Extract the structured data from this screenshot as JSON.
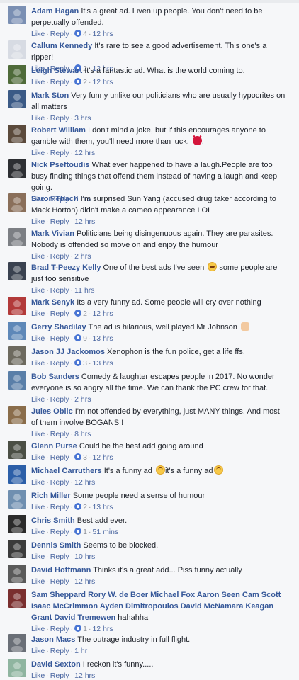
{
  "labels": {
    "like": "Like",
    "reply": "Reply",
    "sep": "·"
  },
  "colors": {
    "name": "#365899",
    "text": "#1d2129",
    "meta": "#90949c",
    "link": "#4b67a1",
    "reaction": "#4a76d4",
    "background": "#f6f7f9"
  },
  "comments": [
    {
      "name": "Adam Hagan",
      "text": "It's a great ad. Liven up people. You don't need to be perpetually offended.",
      "reactions": "4",
      "time": "12 hrs",
      "avatar": "avatar-photo"
    },
    {
      "name": "Callum Kennedy",
      "text": "It's rare to see a good advertisement. This one's a ripper!",
      "reactions": "2",
      "time": "12 hrs",
      "avatar": "avatar-photo"
    },
    {
      "name": "Leigh Stewart",
      "text": "It's a fantastic ad. What is the world coming to.",
      "reactions": "2",
      "time": "12 hrs",
      "avatar": "avatar-photo"
    },
    {
      "name": "Mark Ston",
      "text": "Very funny unlike our politicians who are usually hypocrites on all matters",
      "reactions": null,
      "time": "3 hrs",
      "avatar": "avatar-photo"
    },
    {
      "name": "Robert William",
      "text": "I don't mind a joke, but if this encourages anyone to gamble with them, you'll need more than luck.",
      "emoji": "devil-emoji",
      "emoji_after": ".",
      "reactions": null,
      "time": "12 hrs",
      "avatar": "avatar-photo"
    },
    {
      "name": "Nick Pseftoudis",
      "text": "What ever happened to have a laugh.People are too busy finding things that offend them instead of having a laugh and keep going.",
      "reactions": null,
      "time": "4 hrs",
      "avatar": "avatar-photo"
    },
    {
      "name": "Saron Thach",
      "text": "I'm surprised Sun Yang (accused drug taker according to Mack Horton) didn't make a cameo appearance LOL",
      "reactions": null,
      "time": "12 hrs",
      "avatar": "avatar-photo"
    },
    {
      "name": "Mark Vivian",
      "text": "Politicians being disingenuous again. They are parasites. Nobody is offended so move on and enjoy the humour",
      "reactions": null,
      "time": "2 hrs",
      "avatar": "avatar-photo"
    },
    {
      "name": "Brad T-Peezy Kelly",
      "text": "One of the best ads I've seen",
      "emoji": "laughing-emoji",
      "emoji_after": " some people are just too sensitive",
      "reactions": null,
      "time": "11 hrs",
      "avatar": "avatar-photo"
    },
    {
      "name": "Mark Senyk",
      "text": "Its a very funny ad. Some people will cry over nothing",
      "reactions": "2",
      "time": "12 hrs",
      "avatar": "avatar-photo"
    },
    {
      "name": "Gerry Shadilay",
      "text": "The ad is hilarious, well played Mr Johnson",
      "emoji": "clap-emoji",
      "emoji_after": "",
      "reactions": "9",
      "time": "13 hrs",
      "avatar": "avatar-photo"
    },
    {
      "name": "Jason JJ Jackomos",
      "text": "Xenophon is the fun police, get a life ffs.",
      "reactions": "3",
      "time": "13 hrs",
      "avatar": "avatar-photo"
    },
    {
      "name": "Bob Sanders",
      "text": "Comedy & laughter escapes people in 2017. No wonder everyone is so angry all the time. We can thank the PC crew for that.",
      "reactions": null,
      "time": "2 hrs",
      "avatar": "avatar-photo"
    },
    {
      "name": "Jules Oblic",
      "text": "I'm not offended by everything, just MANY things. And most of them involve BOGANS !",
      "reactions": null,
      "time": "8 hrs",
      "avatar": "avatar-photo"
    },
    {
      "name": "Glenn Purse",
      "text": "Could be the best add going around",
      "reactions": "3",
      "time": "12 hrs",
      "avatar": "avatar-photo"
    },
    {
      "name": "Michael Carruthers",
      "text": "It's a funny ad",
      "emoji": "upside-down-emoji",
      "emoji_after": "it's a funny ad",
      "emoji2": "upside-down-emoji",
      "reactions": null,
      "time": "12 hrs",
      "avatar": "avatar-photo"
    },
    {
      "name": "Rich Miller",
      "text": "Some people need a sense of humour",
      "reactions": "2",
      "time": "13 hrs",
      "avatar": "avatar-photo"
    },
    {
      "name": "Chris Smith",
      "text": "Best add ever.",
      "reactions": "1",
      "time": "51 mins",
      "avatar": "avatar-photo"
    },
    {
      "name": "Dennis Smith",
      "text": "Seems to be blocked.",
      "reactions": null,
      "time": "10 hrs",
      "avatar": "avatar-photo"
    },
    {
      "name": "David Hoffmann",
      "text": "Thinks it's a great add... Piss funny actually",
      "reactions": null,
      "time": "12 hrs",
      "avatar": "avatar-photo"
    },
    {
      "name": "Sam Sheppard",
      "text": "",
      "tags": "Rory W. de Boer Michael Fox Aaron Seen Cam Scott Isaac McCrimmon Ayden Dimitropoulos David McNamara Keagan Grant David Tremewen",
      "emoji_after": " hahahha",
      "reactions": "1",
      "time": "12 hrs",
      "avatar": "avatar-photo"
    },
    {
      "name": "Jason Macs",
      "text": "The outrage industry in full flight.",
      "reactions": null,
      "time": "1 hr",
      "avatar": "avatar-photo"
    },
    {
      "name": "David Sexton",
      "text": "I reckon it's funny.....",
      "reactions": null,
      "time": "12 hrs",
      "avatar": "avatar-photo"
    }
  ]
}
